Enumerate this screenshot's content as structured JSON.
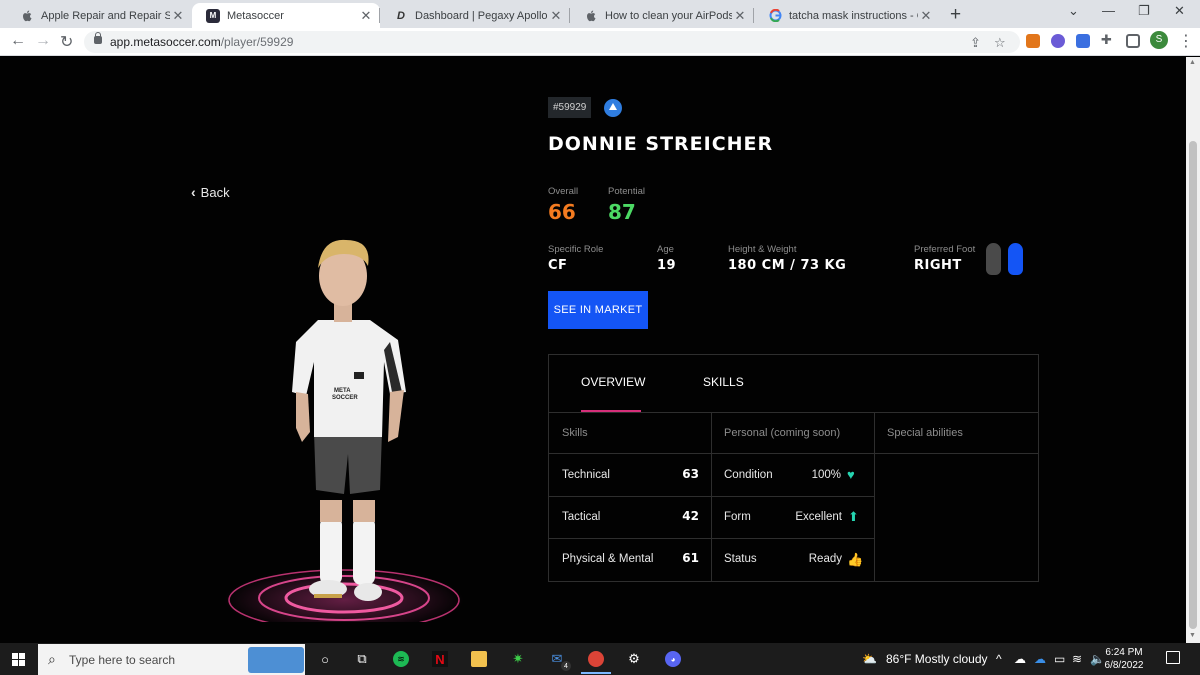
{
  "browser": {
    "tabs": [
      {
        "title": "Apple Repair and Repair Status O",
        "favicon": "apple-icon",
        "active": false
      },
      {
        "title": "Metasoccer",
        "favicon": "metasoccer-icon",
        "active": true
      },
      {
        "title": "Dashboard | Pegaxy Apollo",
        "favicon": "pegaxy-icon",
        "active": false
      },
      {
        "title": "How to clean your AirPods, AirPo",
        "favicon": "apple-icon",
        "active": false
      },
      {
        "title": "tatcha mask instructions - Googl",
        "favicon": "google-icon",
        "active": false
      }
    ],
    "address": {
      "domain": "app.metasoccer.com",
      "path": "/player/59929"
    },
    "profile_initial": "S"
  },
  "page": {
    "back_label": "Back",
    "player_id": "#59929",
    "player_name": "DONNIE STREICHER",
    "overall": {
      "label": "Overall",
      "value": "66",
      "color": "#f47b20"
    },
    "potential": {
      "label": "Potential",
      "value": "87",
      "color": "#4cd964"
    },
    "role": {
      "label": "Specific Role",
      "value": "CF"
    },
    "age": {
      "label": "Age",
      "value": "19"
    },
    "height_weight": {
      "label": "Height & Weight",
      "value": "180 CM / 73 KG"
    },
    "preferred_foot": {
      "label": "Preferred Foot",
      "value": "RIGHT"
    },
    "market_button": "SEE IN MARKET",
    "tabs": {
      "overview": "OVERVIEW",
      "skills": "SKILLS"
    },
    "columns": {
      "skills": "Skills",
      "personal": "Personal (coming soon)",
      "special": "Special abilities"
    },
    "skills": [
      {
        "name": "Technical",
        "value": "63"
      },
      {
        "name": "Tactical",
        "value": "42"
      },
      {
        "name": "Physical & Mental",
        "value": "61"
      }
    ],
    "personal": [
      {
        "name": "Condition",
        "value": "100%",
        "icon": "heart-icon"
      },
      {
        "name": "Form",
        "value": "Excellent",
        "icon": "arrow-up-icon"
      },
      {
        "name": "Status",
        "value": "Ready",
        "icon": "thumbs-up-icon"
      }
    ],
    "jersey_text": [
      "META",
      "SOCCER"
    ]
  },
  "taskbar": {
    "search_placeholder": "Type here to search",
    "weather": "86°F  Mostly cloudy",
    "time": "6:24 PM",
    "date": "6/8/2022",
    "mail_badge": "4"
  },
  "colors": {
    "accent_blue": "#1455f5",
    "tab_underline": "#d62f7a",
    "stat_icon": "#25d4b0"
  }
}
